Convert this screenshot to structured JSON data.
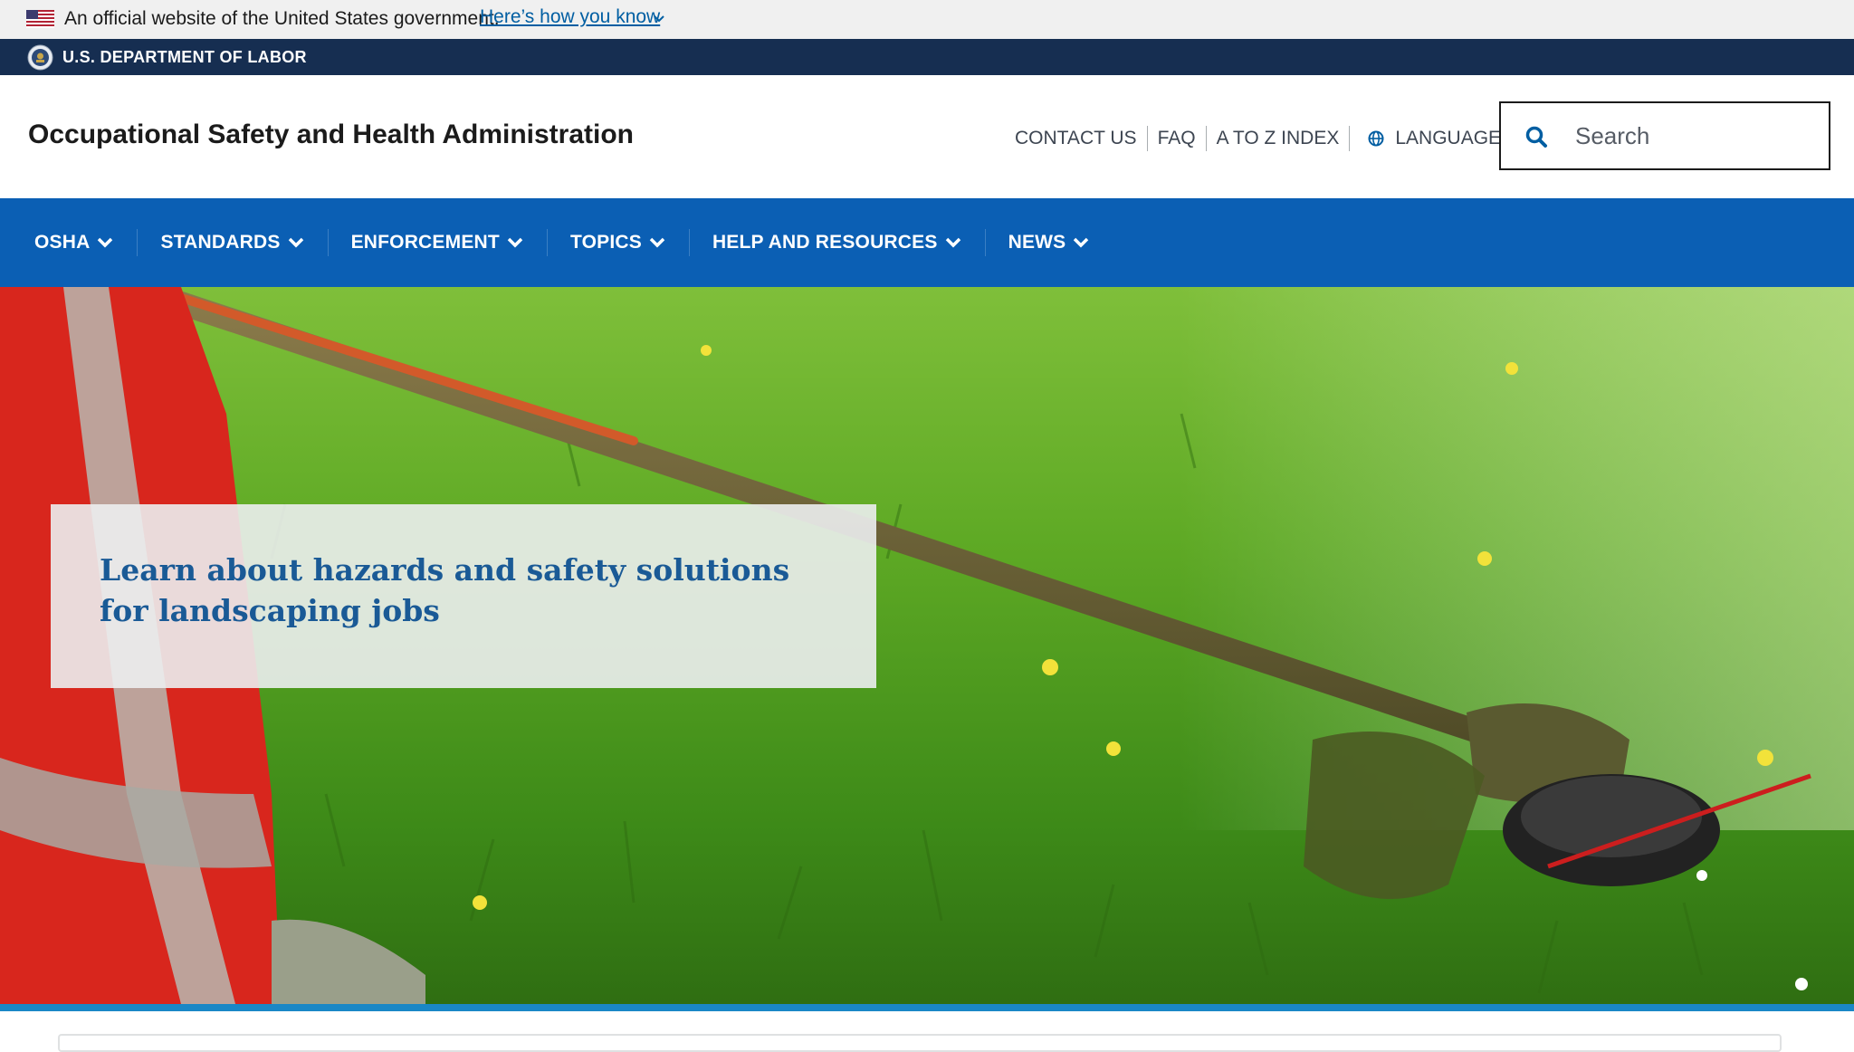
{
  "gov_banner": {
    "text": "An official website of the United States government.",
    "link": "Here’s how you know"
  },
  "agency_bar": {
    "text": "U.S. DEPARTMENT OF LABOR"
  },
  "header": {
    "title": "Occupational Safety and Health Administration",
    "utility_links": [
      {
        "label": "CONTACT US"
      },
      {
        "label": "FAQ"
      },
      {
        "label": "A TO Z INDEX"
      }
    ],
    "languages": "LANGUAGES",
    "search": {
      "placeholder": "Search",
      "value": ""
    }
  },
  "main_nav": {
    "items": [
      {
        "label": "OSHA"
      },
      {
        "label": "STANDARDS"
      },
      {
        "label": "ENFORCEMENT"
      },
      {
        "label": "TOPICS"
      },
      {
        "label": "HELP AND RESOURCES"
      },
      {
        "label": "NEWS"
      }
    ]
  },
  "hero": {
    "headline": "Learn about hazards and safety solutions for landscaping jobs"
  },
  "colors": {
    "gov_banner_bg": "#f0f0f0",
    "agency_bar_bg": "#162e51",
    "nav_bg": "#0b5fb4",
    "link": "#005ea2",
    "hero_text": "#1a5a96",
    "hero_border": "#1a87c6"
  },
  "icons": {
    "flag": "us-flag-icon",
    "chevron": "chevron-down-icon",
    "seal": "dol-seal-icon",
    "globe": "globe-icon",
    "search": "search-icon"
  }
}
